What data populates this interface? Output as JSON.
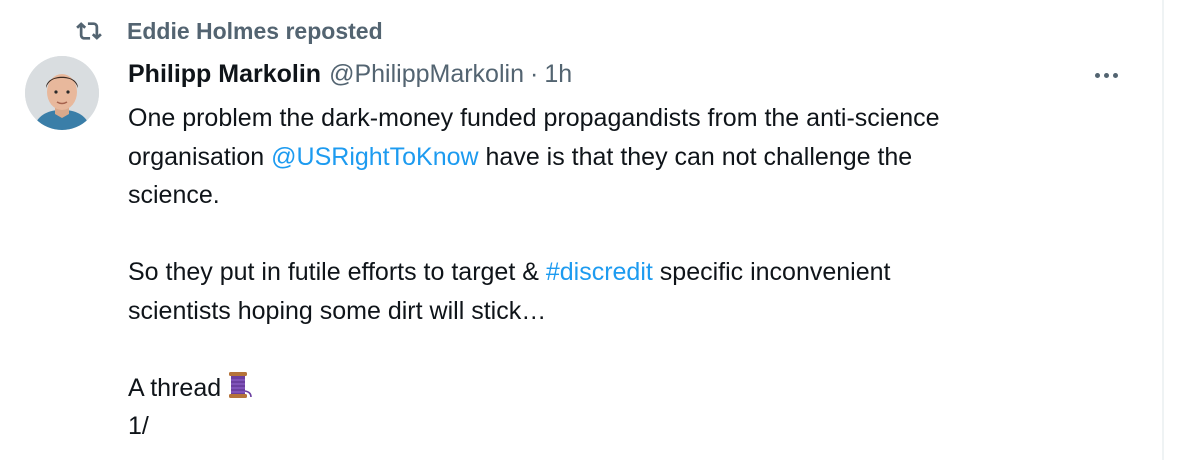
{
  "social_context": {
    "text": "Eddie Holmes reposted"
  },
  "author": {
    "name": "Philipp Markolin",
    "handle": "@PhilippMarkolin",
    "separator": "·",
    "time": "1h"
  },
  "tweet": {
    "p1_a": "One problem the dark-money funded propagandists from the anti-science",
    "p1_b": "organisation ",
    "p1_mention": "@USRightToKnow",
    "p1_c": " have is that they can not challenge the",
    "p1_d": "science.",
    "p2_a": "So they put in futile efforts to target & ",
    "p2_hashtag": "#discredit",
    "p2_b": " specific inconvenient",
    "p2_c": "scientists hoping some dirt will stick…",
    "p3_a": "A thread",
    "p3_b": "1/"
  },
  "icons": [
    "repost-icon",
    "avatar",
    "more-icon",
    "thread-spool-emoji"
  ],
  "colors": {
    "link": "#1d9bf0",
    "secondary": "#536471",
    "text": "#0f1419"
  }
}
